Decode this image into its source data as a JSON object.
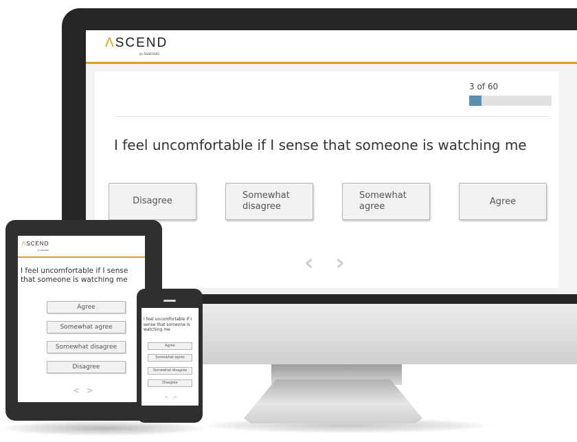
{
  "brand": {
    "name_accent": "Λ",
    "name_rest": "SCEND",
    "byline": "by ASSESSIO",
    "accent_color": "#d9a01a"
  },
  "desktop": {
    "progress": {
      "label": "3 of 60",
      "fraction": 0.05,
      "color": "#5b8fb2"
    },
    "question": "I feel uncomfortable if I sense that someone is watching me",
    "answers": [
      "Disagree",
      "Somewhat\ndisagree",
      "Somewhat\nagree",
      "Agree"
    ],
    "nav": {
      "prev": "‹",
      "next": "›"
    }
  },
  "tablet": {
    "question": "I feel uncomfortable if I sense that someone is watching me",
    "answers": [
      "Agree",
      "Somewhat agree",
      "Somewhat disagree",
      "Disagree"
    ],
    "nav": {
      "prev": "<",
      "next": ">"
    }
  },
  "phone": {
    "question": "I feel uncomfortable if I sense that someone is watching me",
    "answers": [
      "Agree",
      "Somewhat agree",
      "Somewhat disagree",
      "Disagree"
    ],
    "nav": {
      "prev": "<",
      "next": ">"
    }
  }
}
